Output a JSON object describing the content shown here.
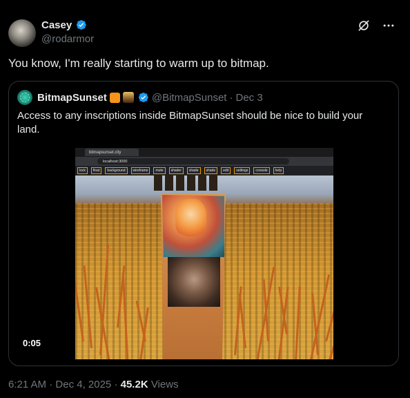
{
  "author": {
    "name": "Casey",
    "handle": "@rodarmor",
    "verified": true
  },
  "icons": {
    "grok": "grok-icon",
    "more": "more-icon",
    "verified": "verified-badge-icon"
  },
  "tweet": {
    "text": "You know, I'm really starting to warm up to bitmap."
  },
  "quote": {
    "name": "BitmapSunset",
    "handle": "@BitmapSunset",
    "separator": "·",
    "date": "Dec 3",
    "text": "Access to any inscriptions inside BitmapSunset should be nice to build your land.",
    "video_duration": "0:05"
  },
  "video_screen": {
    "tab_title": "bitmapsunset.city",
    "url": "localhost:3000",
    "bookmarks": [
      "lock",
      "float",
      "background",
      "wireframe",
      "mute",
      "shader",
      "shade",
      "shade",
      "edit",
      "settings",
      "console",
      "help"
    ]
  },
  "meta": {
    "time": "6:21 AM",
    "separator": "·",
    "date": "Dec 4, 2025",
    "views_count": "45.2K",
    "views_label": "Views"
  },
  "colors": {
    "background": "#000000",
    "text_primary": "#e7e9ea",
    "text_secondary": "#71767b",
    "verified_blue": "#1d9bf0",
    "border": "#2f3336",
    "bitcoin_orange": "#f7931a"
  }
}
